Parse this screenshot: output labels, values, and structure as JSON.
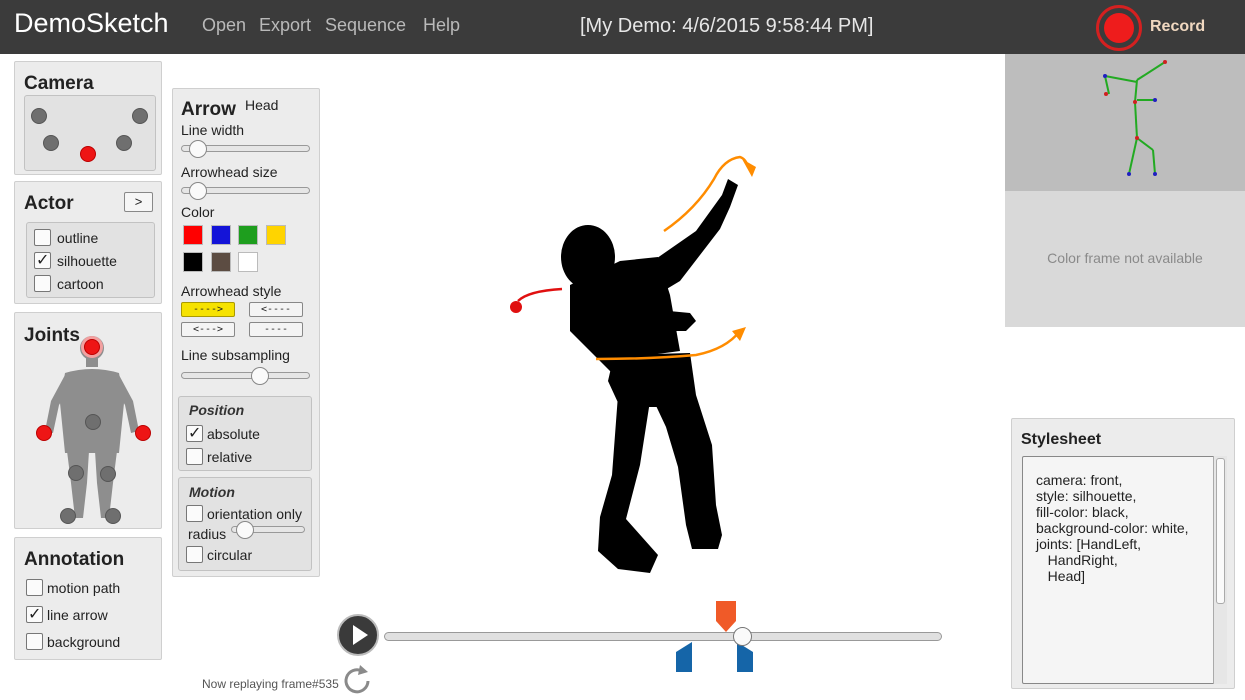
{
  "app": {
    "title": "DemoSketch"
  },
  "menu": [
    {
      "label": "Open"
    },
    {
      "label": "Export"
    },
    {
      "label": "Sequence"
    },
    {
      "label": "Help"
    }
  ],
  "session_title": "[My Demo: 4/6/2015 9:58:44 PM]",
  "record": {
    "label": "Record",
    "color": "#ee1c1c"
  },
  "camera": {
    "title": "Camera",
    "selected_view": "front-center"
  },
  "actor": {
    "title": "Actor",
    "next_label": ">",
    "styles": [
      {
        "label": "outline",
        "checked": false
      },
      {
        "label": "silhouette",
        "checked": true
      },
      {
        "label": "cartoon",
        "checked": false
      }
    ]
  },
  "joints": {
    "title": "Joints",
    "selected": [
      "Head",
      "HandLeft",
      "HandRight"
    ]
  },
  "annotation": {
    "title": "Annotation",
    "items": [
      {
        "label": "motion path",
        "checked": false
      },
      {
        "label": "line arrow",
        "checked": true
      },
      {
        "label": "background",
        "checked": false
      }
    ]
  },
  "arrow": {
    "title": "Arrow",
    "joint_label": "Head",
    "line_width_label": "Line width",
    "line_width_value": 0.1,
    "arrowhead_size_label": "Arrowhead size",
    "arrowhead_size_value": 0.1,
    "color_label": "Color",
    "colors": [
      "#ff0000",
      "#1414d8",
      "#1e9e1e",
      "#ffd400",
      "#000000",
      "#5c4c42",
      "#ffffff"
    ],
    "arrowhead_style_label": "Arrowhead style",
    "arrowhead_styles": [
      {
        "label": "---->",
        "active": true
      },
      {
        "label": "<----",
        "active": false
      },
      {
        "label": "<--->",
        "active": false
      },
      {
        "label": "----",
        "active": false
      }
    ],
    "subsampling_label": "Line subsampling",
    "subsampling_value": 0.6,
    "position": {
      "title": "Position",
      "items": [
        {
          "label": "absolute",
          "checked": true
        },
        {
          "label": "relative",
          "checked": false
        }
      ]
    },
    "motion": {
      "title": "Motion",
      "orientation_label": "orientation only",
      "orientation_checked": false,
      "radius_label": "radius",
      "radius_value": 0.1,
      "circular_label": "circular",
      "circular_checked": false
    }
  },
  "preview": {
    "unavailable_text": "Color frame not available"
  },
  "stylesheet": {
    "title": "Stylesheet",
    "lines": [
      "camera: front,",
      "style: silhouette,",
      "fill-color: black,",
      "background-color: white,",
      "joints: [HandLeft,",
      "   HandRight,",
      "   Head]"
    ]
  },
  "playback": {
    "status": "Now replaying frame#535",
    "progress": 0.64
  },
  "colors": {
    "accent_orange": "#ff8c00",
    "marker_orange": "#f05a28",
    "marker_blue": "#1565a8"
  }
}
